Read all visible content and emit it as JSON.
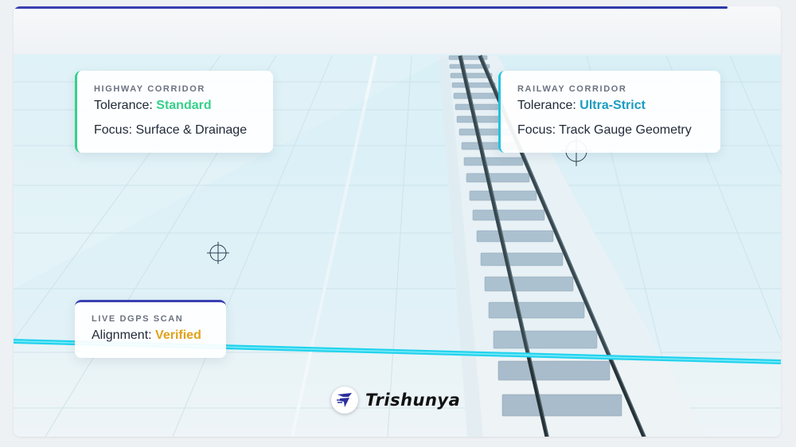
{
  "cards": {
    "highway": {
      "title": "HIGHWAY CORRIDOR",
      "tolerance_label": "Tolerance: ",
      "tolerance_value": "Standard",
      "focus": "Focus: Surface & Drainage"
    },
    "railway": {
      "title": "RAILWAY CORRIDOR",
      "tolerance_label": "Tolerance: ",
      "tolerance_value": "Ultra-Strict",
      "focus": "Focus: Track Gauge Geometry"
    },
    "scan": {
      "title": "LIVE DGPS SCAN",
      "alignment_label": "Alignment: ",
      "alignment_value": "Verified"
    }
  },
  "brand": {
    "name": "Trishunya",
    "logo_icon": "trishunya-logo-icon"
  },
  "colors": {
    "accent_indigo": "#3b3fb3",
    "standard_green": "#35d08a",
    "ultra_strict_cyan": "#1a9cc0",
    "verified_amber": "#e0a21a",
    "scan_line": "#22d3ee"
  }
}
